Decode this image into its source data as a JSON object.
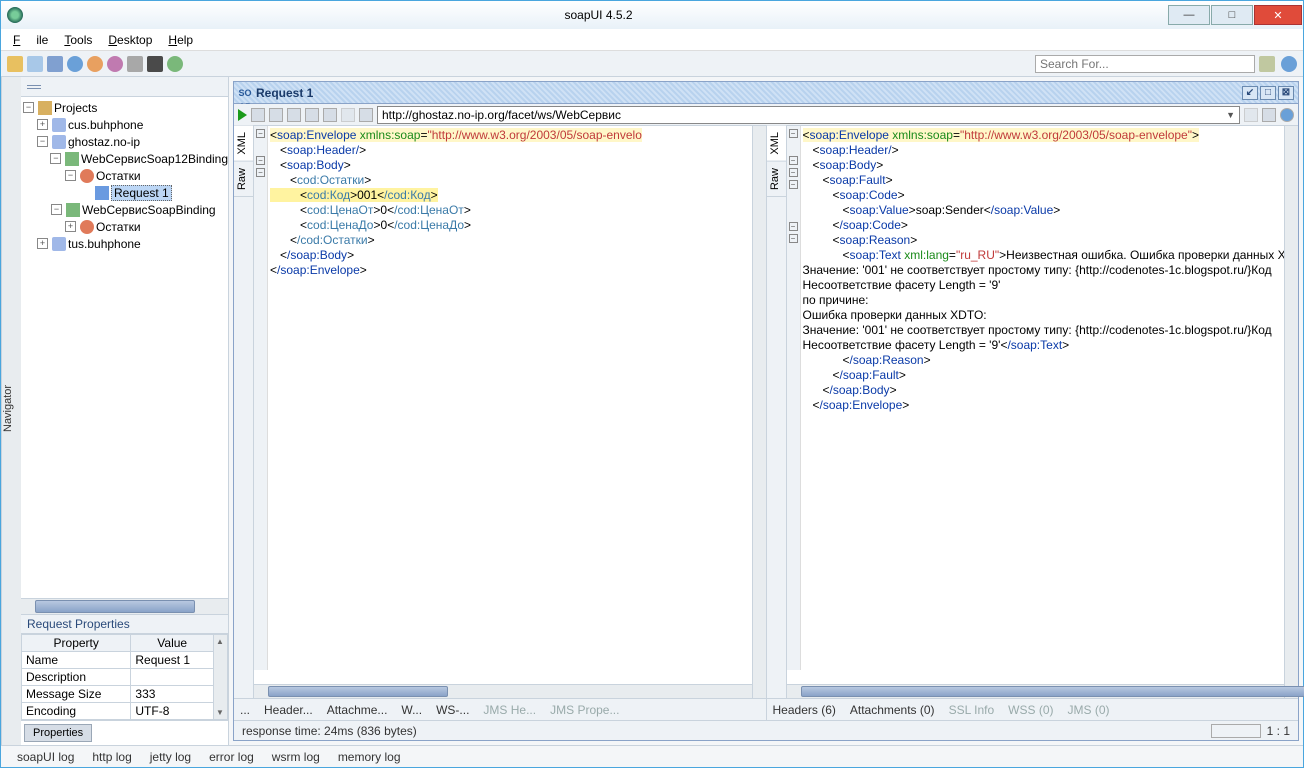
{
  "window": {
    "title": "soapUI 4.5.2"
  },
  "menus": {
    "file": "File",
    "tools": "Tools",
    "desktop": "Desktop",
    "help": "Help"
  },
  "search": {
    "placeholder": "Search For..."
  },
  "navigator": {
    "label": "Navigator",
    "root": "Projects"
  },
  "tree": {
    "n0": "cus.buhphone",
    "n1": "ghostaz.no-ip",
    "n2": "WebСервисSoap12Binding",
    "n3": "Остатки",
    "n4": "Request 1",
    "n5": "WebСервисSoapBinding",
    "n6": "Остатки",
    "n7": "tus.buhphone"
  },
  "props": {
    "title": "Request Properties",
    "hProp": "Property",
    "hVal": "Value",
    "r0k": "Name",
    "r0v": "Request 1",
    "r1k": "Description",
    "r1v": "",
    "r2k": "Message Size",
    "r2v": "333",
    "r3k": "Encoding",
    "r3v": "UTF-8",
    "btn": "Properties"
  },
  "request": {
    "title": "Request 1",
    "url": "http://ghostaz.no-ip.org/facet/ws/WebСервис",
    "tabXML": "XML",
    "tabRaw": "Raw",
    "reqTabs": {
      "more": "...",
      "headers": "Header...",
      "attach": "Attachme...",
      "w": "W...",
      "ws": "WS-...",
      "jmsh": "JMS He...",
      "jmsp": "JMS Prope..."
    },
    "resTabs": {
      "headers": "Headers (6)",
      "attach": "Attachments (0)",
      "ssl": "SSL Info",
      "wss": "WSS (0)",
      "jms": "JMS (0)"
    },
    "status": "response time: 24ms (836 bytes)",
    "ratio": "1 : 1"
  },
  "reqXml": {
    "envOpen": "soap:Envelope",
    "envNs": "xmlns:soap",
    "envNsV": "\"http://www.w3.org/2003/05/soap-envelo",
    "header": "soap:Header/",
    "bodyOpen": "soap:Body",
    "bodyClose": "/soap:Body",
    "ostOpen": "cod:Остатки",
    "ostClose": "/cod:Остатки",
    "kodOpen": "cod:Код",
    "kodVal": "001",
    "kodClose": "/cod:Код",
    "c1Open": "cod:ЦенаОт",
    "c1Val": "0",
    "c1Close": "/cod:ЦенаОт",
    "c2Open": "cod:ЦенаДо",
    "c2Val": "0",
    "c2Close": "/cod:ЦенаДо",
    "envClose": "/soap:Envelope"
  },
  "resXml": {
    "envOpen": "soap:Envelope",
    "envNs": "xmlns:soap",
    "envNsV": "\"http://www.w3.org/2003/05/soap-envelope\"",
    "header": "soap:Header/",
    "bodyOpen": "soap:Body",
    "bodyClose": "/soap:Body",
    "faultOpen": "soap:Fault",
    "faultClose": "/soap:Fault",
    "codeOpen": "soap:Code",
    "codeClose": "/soap:Code",
    "valueOpen": "soap:Value",
    "valueVal": "soap:Sender",
    "valueClose": "/soap:Value",
    "reasonOpen": "soap:Reason",
    "reasonClose": "/soap:Reason",
    "textOpen": "soap:Text",
    "textAttr": "xml:lang",
    "textAttrV": "\"ru_RU\"",
    "textClose": "/soap:Text",
    "err1": "Неизвестная ошибка. Ошибка проверки данных XDTO:",
    "err2": "Значение: '001' не соответствует простому типу: {http://codenotes-1c.blogspot.ru/}Код",
    "err3": "Несоответствие фасету Length = '9'",
    "err4": "по причине:",
    "err5": "Ошибка проверки данных XDTO:",
    "err6": "Значение: '001' не соответствует простому типу: {http://codenotes-1c.blogspot.ru/}Код",
    "err7": "Несоответствие фасету Length = '9'",
    "envClose": "/soap:Envelope"
  },
  "logs": {
    "l0": "soapUI log",
    "l1": "http log",
    "l2": "jetty log",
    "l3": "error log",
    "l4": "wsrm log",
    "l5": "memory log"
  }
}
